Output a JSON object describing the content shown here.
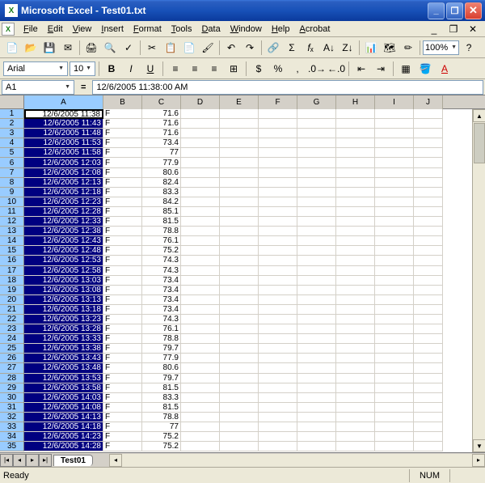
{
  "window": {
    "title": "Microsoft Excel - Test01.txt"
  },
  "menus": [
    "File",
    "Edit",
    "View",
    "Insert",
    "Format",
    "Tools",
    "Data",
    "Window",
    "Help",
    "Acrobat"
  ],
  "toolbar": {
    "zoom": "100%"
  },
  "format": {
    "font": "Arial",
    "size": "10"
  },
  "formula": {
    "name_box": "A1",
    "content": "12/6/2005  11:38:00 AM"
  },
  "columns": [
    "A",
    "B",
    "C",
    "D",
    "E",
    "F",
    "G",
    "H",
    "I",
    "J"
  ],
  "rows": [
    {
      "n": 1,
      "a": "12/6/2005 11:38",
      "b": "F",
      "c": "71.6"
    },
    {
      "n": 2,
      "a": "12/6/2005 11:43",
      "b": "F",
      "c": "71.6"
    },
    {
      "n": 3,
      "a": "12/6/2005 11:48",
      "b": "F",
      "c": "71.6"
    },
    {
      "n": 4,
      "a": "12/6/2005 11:53",
      "b": "F",
      "c": "73.4"
    },
    {
      "n": 5,
      "a": "12/6/2005 11:58",
      "b": "F",
      "c": "77"
    },
    {
      "n": 6,
      "a": "12/6/2005 12:03",
      "b": "F",
      "c": "77.9"
    },
    {
      "n": 7,
      "a": "12/6/2005 12:08",
      "b": "F",
      "c": "80.6"
    },
    {
      "n": 8,
      "a": "12/6/2005 12:13",
      "b": "F",
      "c": "82.4"
    },
    {
      "n": 9,
      "a": "12/6/2005 12:18",
      "b": "F",
      "c": "83.3"
    },
    {
      "n": 10,
      "a": "12/6/2005 12:23",
      "b": "F",
      "c": "84.2"
    },
    {
      "n": 11,
      "a": "12/6/2005 12:28",
      "b": "F",
      "c": "85.1"
    },
    {
      "n": 12,
      "a": "12/6/2005 12:33",
      "b": "F",
      "c": "81.5"
    },
    {
      "n": 13,
      "a": "12/6/2005 12:38",
      "b": "F",
      "c": "78.8"
    },
    {
      "n": 14,
      "a": "12/6/2005 12:43",
      "b": "F",
      "c": "76.1"
    },
    {
      "n": 15,
      "a": "12/6/2005 12:48",
      "b": "F",
      "c": "75.2"
    },
    {
      "n": 16,
      "a": "12/6/2005 12:53",
      "b": "F",
      "c": "74.3"
    },
    {
      "n": 17,
      "a": "12/6/2005 12:58",
      "b": "F",
      "c": "74.3"
    },
    {
      "n": 18,
      "a": "12/6/2005 13:03",
      "b": "F",
      "c": "73.4"
    },
    {
      "n": 19,
      "a": "12/6/2005 13:08",
      "b": "F",
      "c": "73.4"
    },
    {
      "n": 20,
      "a": "12/6/2005 13:13",
      "b": "F",
      "c": "73.4"
    },
    {
      "n": 21,
      "a": "12/6/2005 13:18",
      "b": "F",
      "c": "73.4"
    },
    {
      "n": 22,
      "a": "12/6/2005 13:23",
      "b": "F",
      "c": "74.3"
    },
    {
      "n": 23,
      "a": "12/6/2005 13:28",
      "b": "F",
      "c": "76.1"
    },
    {
      "n": 24,
      "a": "12/6/2005 13:33",
      "b": "F",
      "c": "78.8"
    },
    {
      "n": 25,
      "a": "12/6/2005 13:38",
      "b": "F",
      "c": "79.7"
    },
    {
      "n": 26,
      "a": "12/6/2005 13:43",
      "b": "F",
      "c": "77.9"
    },
    {
      "n": 27,
      "a": "12/6/2005 13:48",
      "b": "F",
      "c": "80.6"
    },
    {
      "n": 28,
      "a": "12/6/2005 13:53",
      "b": "F",
      "c": "79.7"
    },
    {
      "n": 29,
      "a": "12/6/2005 13:58",
      "b": "F",
      "c": "81.5"
    },
    {
      "n": 30,
      "a": "12/6/2005 14:03",
      "b": "F",
      "c": "83.3"
    },
    {
      "n": 31,
      "a": "12/6/2005 14:08",
      "b": "F",
      "c": "81.5"
    },
    {
      "n": 32,
      "a": "12/6/2005 14:13",
      "b": "F",
      "c": "78.8"
    },
    {
      "n": 33,
      "a": "12/6/2005 14:18",
      "b": "F",
      "c": "77"
    },
    {
      "n": 34,
      "a": "12/6/2005 14:23",
      "b": "F",
      "c": "75.2"
    },
    {
      "n": 35,
      "a": "12/6/2005 14:28",
      "b": "F",
      "c": "75.2"
    }
  ],
  "sheet_tab": "Test01",
  "status": {
    "left": "Ready",
    "num": "NUM"
  }
}
